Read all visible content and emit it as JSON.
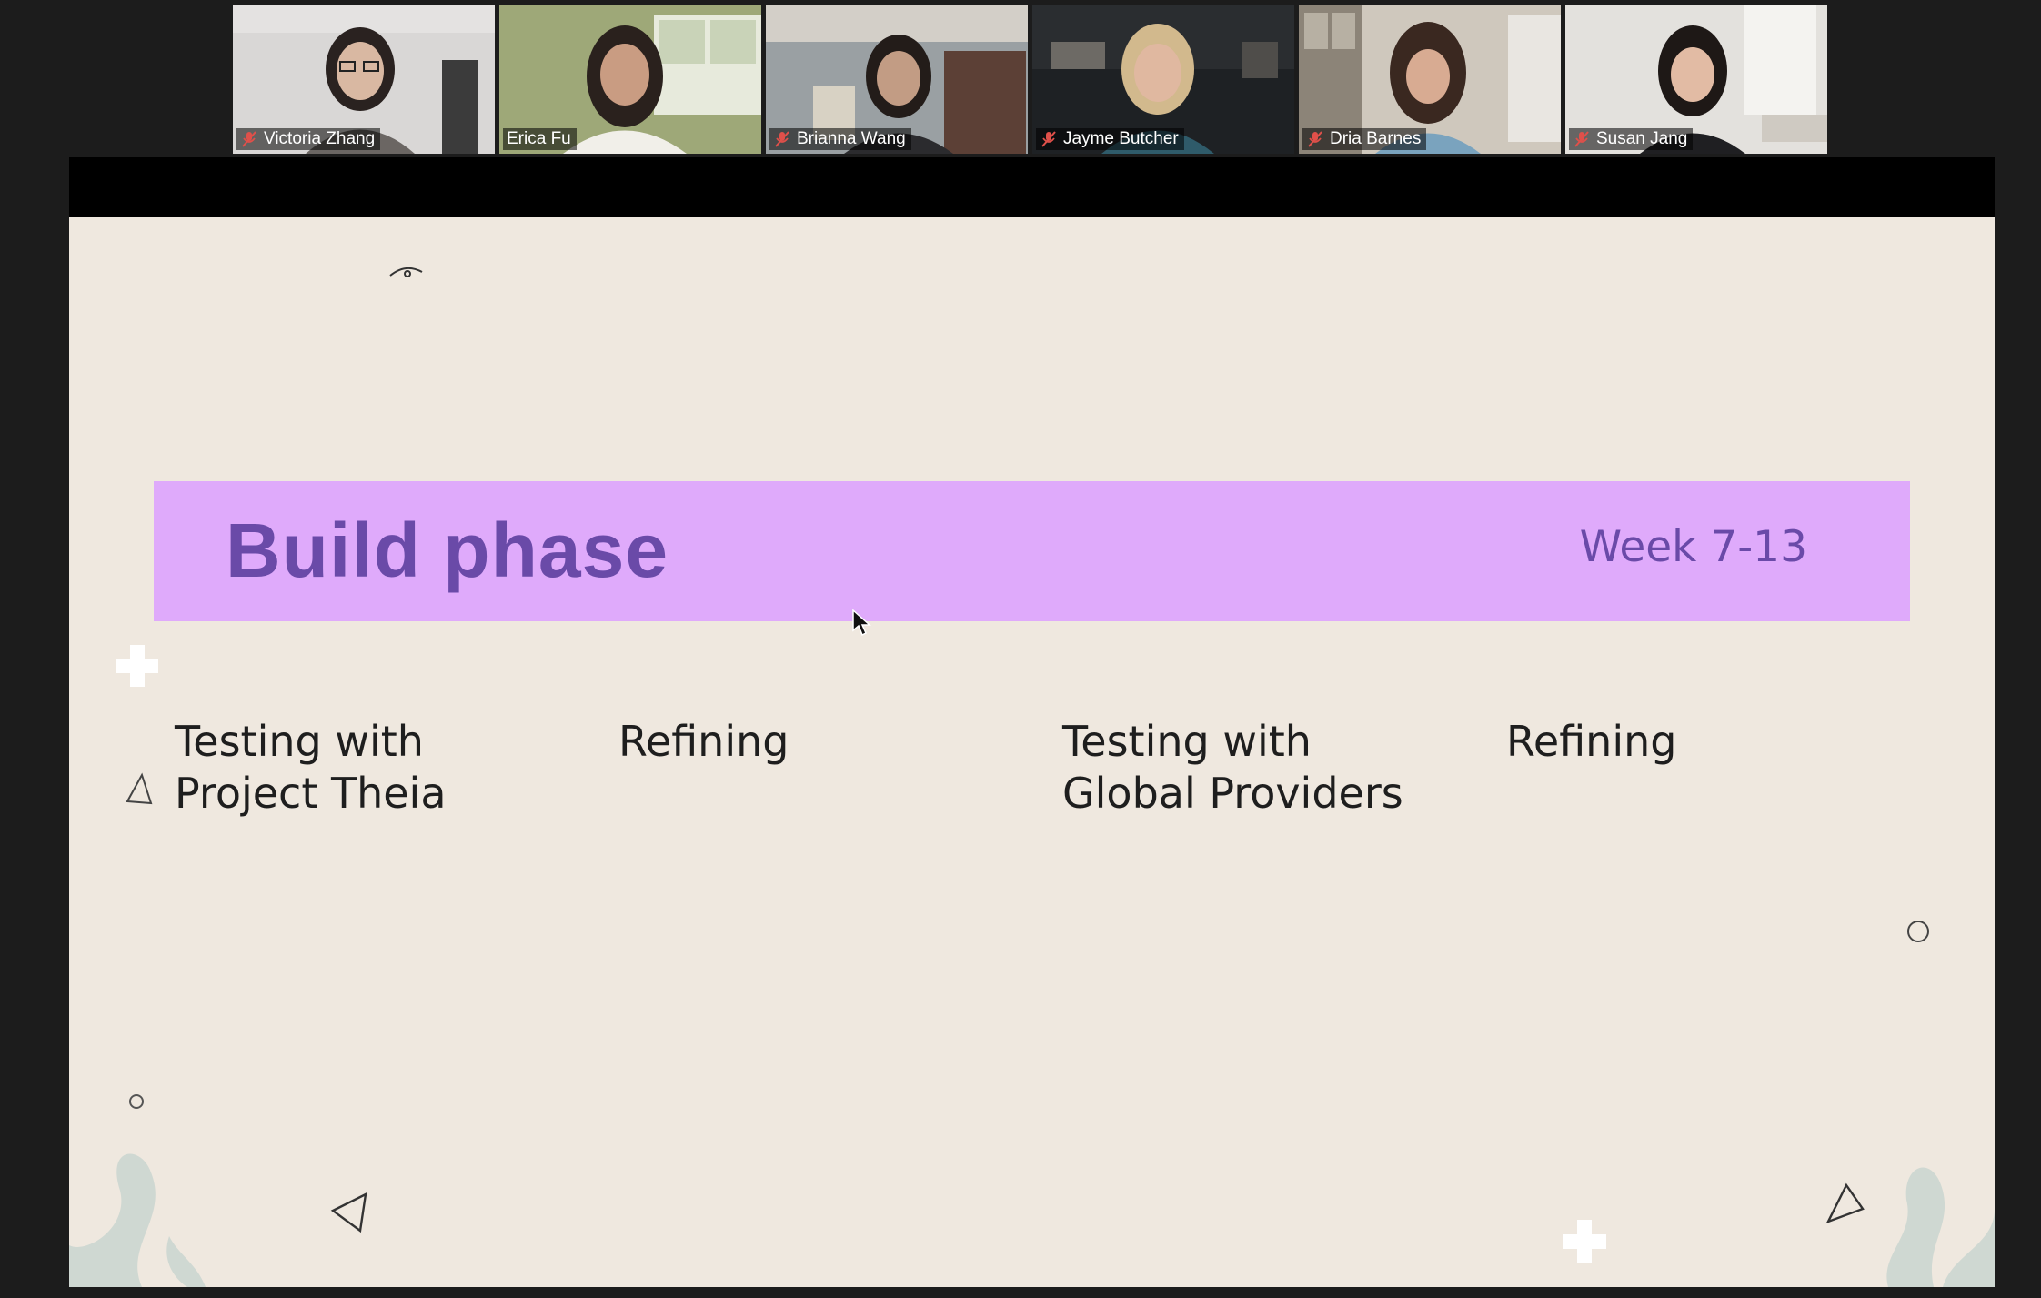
{
  "participants": [
    {
      "name": "Victoria Zhang",
      "muted": true,
      "active": false
    },
    {
      "name": "Erica Fu",
      "muted": false,
      "active": true
    },
    {
      "name": "Brianna Wang",
      "muted": true,
      "active": false
    },
    {
      "name": "Jayme Butcher",
      "muted": true,
      "active": false
    },
    {
      "name": "Dria Barnes",
      "muted": true,
      "active": false
    },
    {
      "name": "Susan Jang",
      "muted": true,
      "active": false
    }
  ],
  "slide": {
    "title": "Build phase",
    "week": "Week 7-13",
    "columns": [
      {
        "line1": "Testing with",
        "line2": "Project Theia"
      },
      {
        "line1": "Refining",
        "line2": ""
      },
      {
        "line1": "Testing with",
        "line2": "Global Providers"
      },
      {
        "line1": "Refining",
        "line2": ""
      }
    ]
  },
  "colors": {
    "banner": "#dfaafb",
    "title": "#6a4aa8",
    "slide_bg": "#efe8df",
    "active_speaker": "#8fcf3a",
    "mic_off": "#e0504a"
  },
  "icons": [
    "mic-off-icon",
    "mouse-cursor-icon"
  ]
}
